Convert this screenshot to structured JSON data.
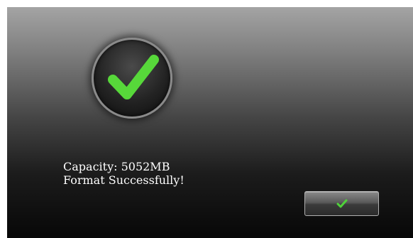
{
  "dialog": {
    "status_icon": "check-icon",
    "capacity_text": "Capacity: 5052MB",
    "status_text": "Format Successfully!",
    "confirm_button_icon": "check-icon"
  },
  "colors": {
    "check_green": "#57d83a",
    "button_check_green": "#4fd23a",
    "text": "#ffffff"
  }
}
